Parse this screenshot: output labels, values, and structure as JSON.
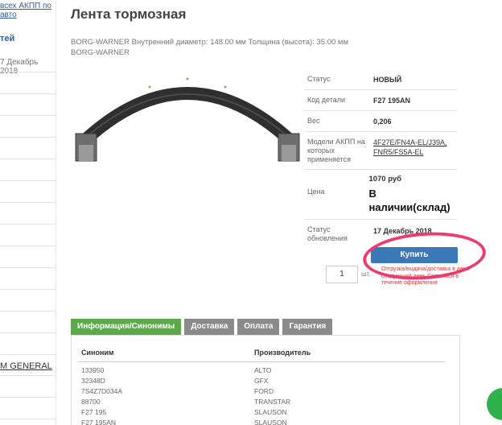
{
  "sidebar": {
    "top_link_line1": "всех АКПП по",
    "top_link_line2": "авто",
    "news_title": "тей",
    "news_date": "7 Декабрь 2018",
    "brand_link": "M GENERAL"
  },
  "product": {
    "title": "Лента тормозная",
    "description": "BORG-WARNER Внутренний диаметр: 148.00 мм Толщина (высота): 35.00 мм BORG-WARNER"
  },
  "specs": {
    "status_label": "Статус",
    "status_value": "НОВЫЙ",
    "code_label": "Код детали",
    "code_value": "F27 195AN",
    "weight_label": "Вес",
    "weight_value": "0,206",
    "models_label": "Модели АКПП на которых применяется",
    "models_value": "4F27E/FN4A-EL/J39A, FNR5/FS5A-EL",
    "price_label": "Цена",
    "price_value": "1070 руб",
    "stock_value": "В наличии(склад)",
    "updated_label": "Статус обновления",
    "updated_value": "17 Декабрь 2018"
  },
  "buy": {
    "quantity": "1",
    "unit": "шт.",
    "button_label": "Купить",
    "note": "Отгрузка/выдача/доставка в день следующий день Свяжемся в течение оформления"
  },
  "tabs": [
    {
      "label": "Информация/Синонимы"
    },
    {
      "label": "Доставка"
    },
    {
      "label": "Оплата"
    },
    {
      "label": "Гарантия"
    }
  ],
  "synonyms": {
    "col1_header": "Синоним",
    "col2_header": "Производитель",
    "rows": [
      {
        "synonym": "133950",
        "maker": "ALTO"
      },
      {
        "synonym": "32348D",
        "maker": "GFX"
      },
      {
        "synonym": "7S4Z7D034A",
        "maker": "FORD"
      },
      {
        "synonym": "88700",
        "maker": "TRANSTAR"
      },
      {
        "synonym": "F27 195",
        "maker": "SLAUSON"
      },
      {
        "synonym": "F27 195AN",
        "maker": "SLAUSON"
      }
    ]
  },
  "colors": {
    "accent_blue": "#3a78b8",
    "tab_active": "#5da84a",
    "tab_inactive": "#8a8a8a",
    "highlight_pink": "#ee3a6e",
    "chat_green": "#2fb24c"
  }
}
